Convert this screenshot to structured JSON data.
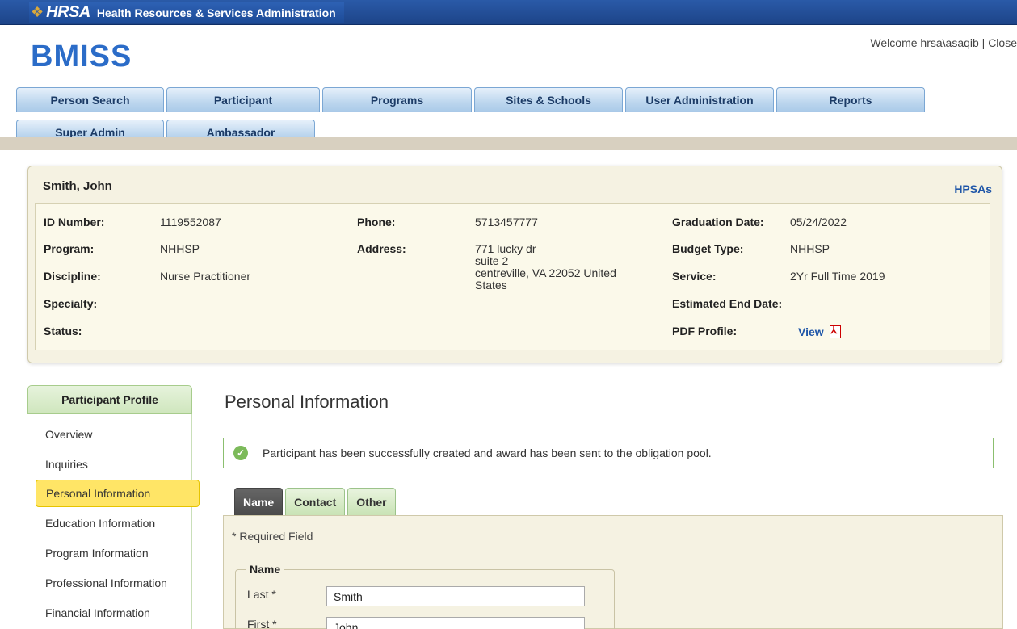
{
  "hrsa": {
    "logo": "HRSA",
    "subtitle": "Health Resources & Services Administration"
  },
  "header": {
    "app_name": "BMISS",
    "welcome": "Welcome hrsa\\asaqib | Close"
  },
  "nav": {
    "row1": [
      "Person Search",
      "Participant",
      "Programs",
      "Sites & Schools",
      "User Administration",
      "Reports"
    ],
    "row2": [
      "Super Admin",
      "Ambassador"
    ]
  },
  "summary": {
    "name": "Smith, John",
    "hpsas_link": "HPSAs",
    "labels": {
      "id": "ID Number:",
      "program": "Program:",
      "discipline": "Discipline:",
      "specialty": "Specialty:",
      "status": "Status:",
      "phone": "Phone:",
      "address": "Address:",
      "graduation": "Graduation Date:",
      "budget": "Budget Type:",
      "service": "Service:",
      "end_date": "Estimated End Date:",
      "pdf": "PDF Profile:"
    },
    "values": {
      "id": "1119552087",
      "program": "NHHSP",
      "discipline": "Nurse Practitioner",
      "specialty": "",
      "status": "",
      "phone": "5713457777",
      "address_line1": "771 lucky dr",
      "address_line2": "suite 2",
      "address_line3": "centreville, VA 22052 United",
      "address_line4": "States",
      "graduation": "05/24/2022",
      "budget": "NHHSP",
      "service": "2Yr Full Time 2019",
      "end_date": "",
      "pdf_link": "View"
    }
  },
  "sidebar": {
    "heading": "Participant Profile",
    "items": [
      "Overview",
      "Inquiries",
      "Personal Information",
      "Education Information",
      "Program Information",
      "Professional Information",
      "Financial Information"
    ],
    "active_index": 2
  },
  "main": {
    "title": "Personal Information",
    "alert": "Participant has been successfully created and award has been sent to the obligation pool.",
    "tabs": [
      "Name",
      "Contact",
      "Other"
    ],
    "required_note": "* Required Field",
    "name_group": {
      "legend": "Name",
      "last_label": "Last *",
      "last_value": "Smith",
      "first_label": "First *",
      "first_value": "John"
    }
  }
}
